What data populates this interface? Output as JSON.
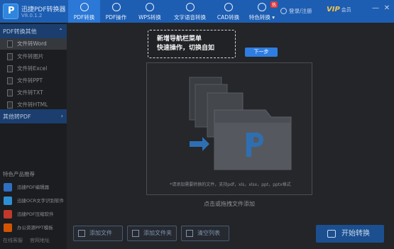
{
  "app": {
    "title": "迅捷PDF转换器",
    "version": "V8.0.1.2",
    "logo_letter": "P"
  },
  "nav": {
    "tabs": [
      {
        "label": "PDF转换"
      },
      {
        "label": "PDF操作"
      },
      {
        "label": "WPS转换"
      },
      {
        "label": "文字语音转换"
      },
      {
        "label": "CAD转换"
      },
      {
        "label": "特色转换 ▾",
        "badge": "热"
      }
    ]
  },
  "user": {
    "login": "登录/注册",
    "vip": "VIP",
    "vip_sub": "会员",
    "minimize": "—",
    "close": "✕"
  },
  "sidebar": {
    "section1": "PDF转换其他",
    "items": [
      {
        "label": "文件转Word"
      },
      {
        "label": "文件转图片"
      },
      {
        "label": "文件转Excel"
      },
      {
        "label": "文件转PPT"
      },
      {
        "label": "文件转TXT"
      },
      {
        "label": "文件转HTML"
      }
    ],
    "section2": "其他转PDF",
    "products_title": "特色产品推荐",
    "products": [
      {
        "label": "迅捷PDF编辑器",
        "color": "#2f6fc4"
      },
      {
        "label": "迅捷OCR文字识别软件",
        "color": "#2f8fd4"
      },
      {
        "label": "迅捷PDF压缩软件",
        "color": "#c0392b"
      },
      {
        "label": "办公资源PPT模板",
        "color": "#d35400"
      }
    ],
    "footer": {
      "qq": "在线客服",
      "site": "官网地址"
    }
  },
  "main": {
    "guide_line1": "新增导航栏菜单",
    "guide_line2": "快速操作，切换自如",
    "next_label": "下一步",
    "drop_text": "点击或拖拽文件添加",
    "hint": "*请添加需要转换的文件，支持pdf，xls，xlsx，ppt，pptx格式",
    "add_file": "添加文件",
    "add_folder": "添加文件夹",
    "clear_list": "清空列表",
    "start": "开始转换"
  }
}
